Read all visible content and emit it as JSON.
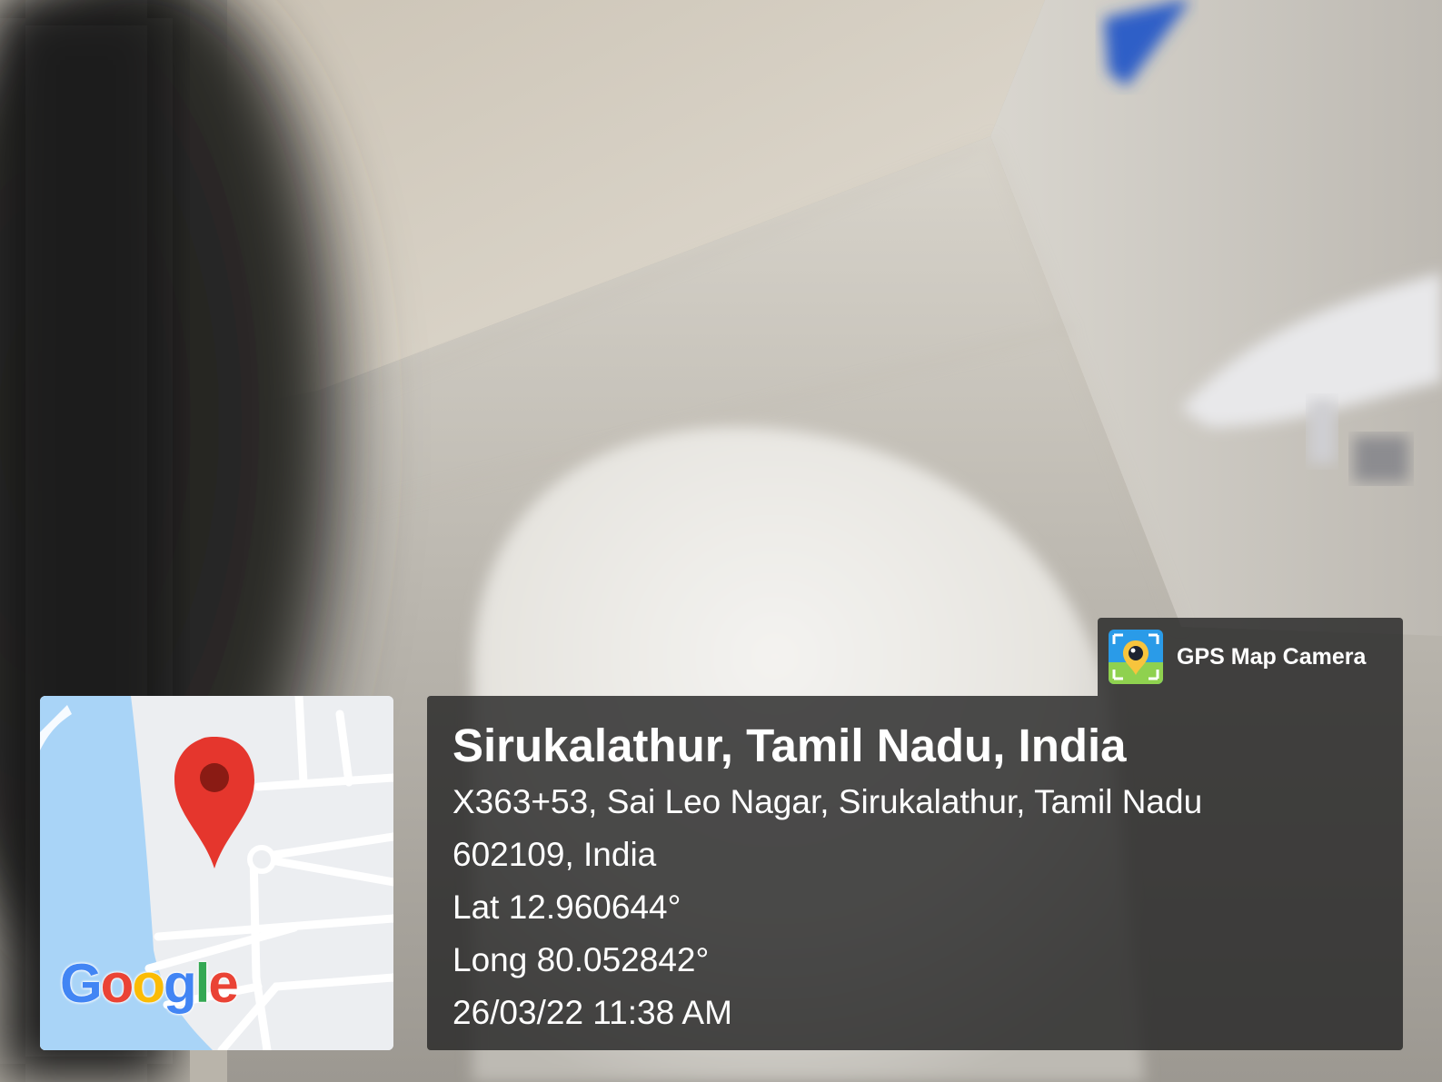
{
  "photo": {
    "description_icon": "camera-photo-background"
  },
  "map": {
    "logo_text": "Google",
    "logo_colors": [
      "#4285F4",
      "#EA4335",
      "#FBBC05",
      "#4285F4",
      "#34A853",
      "#EA4335"
    ],
    "water_color": "#a9d4f7",
    "land_color": "#eceef1",
    "road_color": "#ffffff",
    "pin_color": "#e5362d",
    "pin_icon": "map-pin-icon"
  },
  "brand": {
    "label": "GPS Map Camera",
    "icon": "gps-map-camera-app-icon"
  },
  "location": {
    "title": "Sirukalathur, Tamil Nadu, India",
    "address_line1": "X363+53, Sai Leo Nagar, Sirukalathur, Tamil Nadu",
    "address_line2": "602109, India",
    "latitude": "Lat 12.960644°",
    "longitude": "Long 80.052842°",
    "datetime": "26/03/22 11:38 AM"
  }
}
